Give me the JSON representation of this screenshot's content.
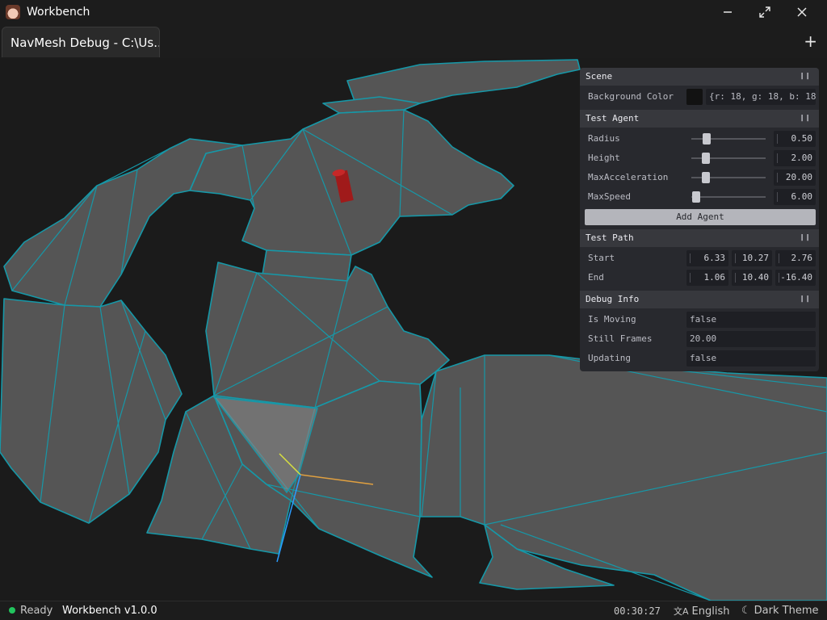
{
  "window": {
    "title": "Workbench",
    "minimize_glyph": "—",
    "maximize_glyph": "⤢",
    "close_glyph": "✕"
  },
  "tabs": [
    {
      "label": "NavMesh Debug - C:\\Us..."
    }
  ],
  "new_tab_glyph": "+",
  "panel": {
    "scene": {
      "title": "Scene",
      "background_color": {
        "label": "Background Color",
        "value": "{r: 18, g: 18, b: 18}",
        "swatch": "#121212"
      }
    },
    "test_agent": {
      "title": "Test Agent",
      "radius": {
        "label": "Radius",
        "value": "0.50",
        "fraction": 0.2
      },
      "height": {
        "label": "Height",
        "value": "2.00",
        "fraction": 0.18
      },
      "max_acceleration": {
        "label": "MaxAcceleration",
        "value": "20.00",
        "fraction": 0.18
      },
      "max_speed": {
        "label": "MaxSpeed",
        "value": "6.00",
        "fraction": 0.0
      },
      "add_agent_label": "Add Agent"
    },
    "test_path": {
      "title": "Test Path",
      "start": {
        "label": "Start",
        "values": [
          "6.33",
          "10.27",
          "2.76"
        ]
      },
      "end": {
        "label": "End",
        "values": [
          "1.06",
          "10.40",
          "-16.40"
        ]
      }
    },
    "debug_info": {
      "title": "Debug Info",
      "is_moving": {
        "label": "Is Moving",
        "value": "false"
      },
      "still_frames": {
        "label": "Still Frames",
        "value": "20.00"
      },
      "updating": {
        "label": "Updating",
        "value": "false"
      }
    }
  },
  "status": {
    "ready": "Ready",
    "version": "Workbench v1.0.0",
    "time": "00:30:27",
    "language": "English",
    "theme": "Dark Theme",
    "ready_color": "#22c55e"
  },
  "colors": {
    "mesh_edge": "#1698a8",
    "mesh_fill": "#555555",
    "agent": "#a01a1a"
  }
}
